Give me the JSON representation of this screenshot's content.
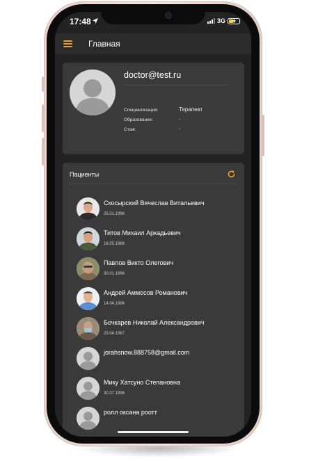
{
  "status_bar": {
    "time": "17:48",
    "network": "3G"
  },
  "app_bar": {
    "title": "Главная"
  },
  "profile": {
    "email": "doctor@test.ru",
    "fields": [
      {
        "label": "Специализация:",
        "value": "Терапевт"
      },
      {
        "label": "Образование:",
        "value": "-"
      },
      {
        "label": "Стаж:",
        "value": "-"
      }
    ]
  },
  "patients": {
    "title": "Пациенты",
    "items": [
      {
        "name": "Скосырский Вячеслав Витальевич",
        "date": "25.01.1996",
        "avatar": "photo-person"
      },
      {
        "name": "Титов Михаил Аркадьевич",
        "date": "18.05.1986",
        "avatar": "photo-person"
      },
      {
        "name": "Павлов Викто Олегович",
        "date": "30.01.1996",
        "avatar": "photo-person"
      },
      {
        "name": "Андрей Аммосов Романович",
        "date": "14.04.1996",
        "avatar": "photo-person"
      },
      {
        "name": "Бочкарев Николай Александрович",
        "date": "25.04.1987",
        "avatar": "photo-person"
      },
      {
        "name": "jorahsnow.888758@gmail.com",
        "date": "",
        "avatar": "default-avatar-icon"
      },
      {
        "name": "Мику Хатсуно Степановна",
        "date": "30.07.1996",
        "avatar": "default-avatar-icon"
      },
      {
        "name": "ролл оксана роотт",
        "date": "",
        "avatar": "default-avatar-icon"
      }
    ]
  },
  "colors": {
    "accent": "#f0a22b",
    "background": "#232323",
    "card": "#3a3a3a",
    "appbar": "#2b2b2b"
  }
}
